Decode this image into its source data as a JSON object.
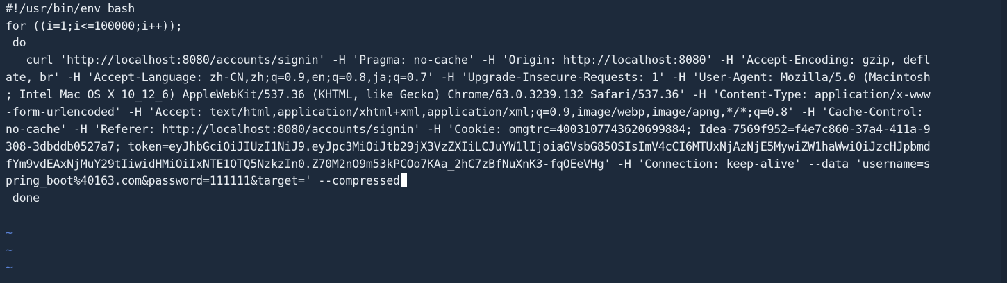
{
  "editor": {
    "lines": [
      "#!/usr/bin/env bash",
      "for ((i=1;i<=100000;i++));",
      " do",
      "   curl 'http://localhost:8080/accounts/signin' -H 'Pragma: no-cache' -H 'Origin: http://localhost:8080' -H 'Accept-Encoding: gzip, defl",
      "ate, br' -H 'Accept-Language: zh-CN,zh;q=0.9,en;q=0.8,ja;q=0.7' -H 'Upgrade-Insecure-Requests: 1' -H 'User-Agent: Mozilla/5.0 (Macintosh",
      "; Intel Mac OS X 10_12_6) AppleWebKit/537.36 (KHTML, like Gecko) Chrome/63.0.3239.132 Safari/537.36' -H 'Content-Type: application/x-www",
      "-form-urlencoded' -H 'Accept: text/html,application/xhtml+xml,application/xml;q=0.9,image/webp,image/apng,*/*;q=0.8' -H 'Cache-Control:",
      "no-cache' -H 'Referer: http://localhost:8080/accounts/signin' -H 'Cookie: omgtrc=4003107743620699884; Idea-7569f952=f4e7c860-37a4-411a-9",
      "308-3dbddb0527a7; token=eyJhbGciOiJIUzI1NiJ9.eyJpc3MiOiJtb29jX3VzZXIiLCJuYW1lIjoiaGVsbG85OSIsImV4cCI6MTUxNjAzNjE5MywiZW1haWwiOiJzcHJpbmd",
      "fYm9vdEAxNjMuY29tIiwidHMiOiIxNTE1OTQ5NzkzIn0.Z70M2nO9m53kPCOo7KAa_2hC7zBfNuXnK3-fqOEeVHg' -H 'Connection: keep-alive' --data 'username=s",
      "pring_boot%40163.com&password=111111&target=' --compressed",
      " done"
    ],
    "empty_line_marker": "~",
    "tilde_count": 3,
    "cursor_line_index": 10
  },
  "colors": {
    "background": "#1d2a3b",
    "text": "#e8edf2",
    "tilde": "#5a82d6",
    "overlay_text": "#ff3b2f"
  }
}
